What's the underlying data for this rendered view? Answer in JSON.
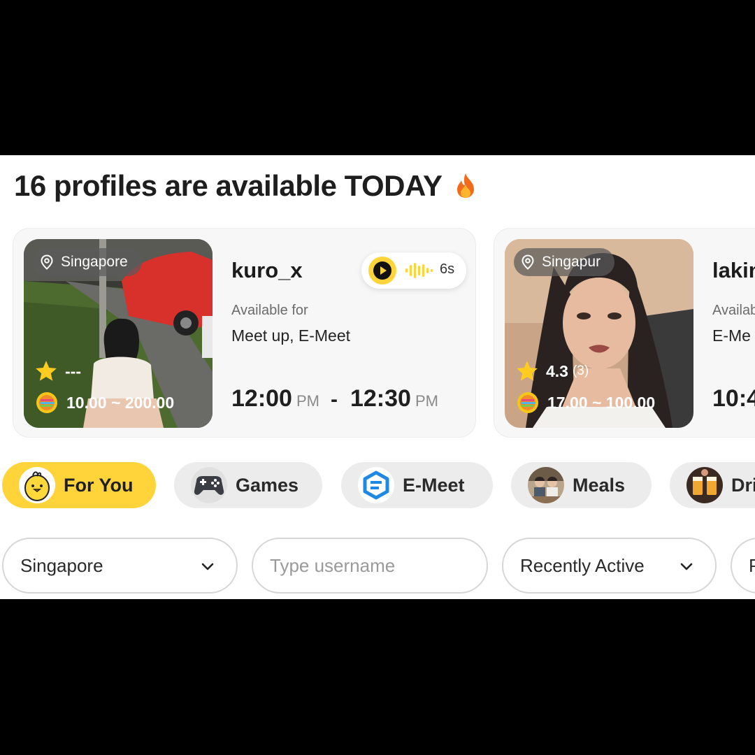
{
  "headline": "16 profiles are available TODAY",
  "profiles": [
    {
      "location": "Singapore",
      "name": "kuro_x",
      "rating": "---",
      "rating_count": "",
      "price": "10.00 ~ 200.00",
      "available_label": "Available for",
      "available": "Meet up, E-Meet",
      "start_time": "12:00",
      "start_ampm": "PM",
      "end_time": "12:30",
      "end_ampm": "PM",
      "voice_duration": "6s"
    },
    {
      "location": "Singapur",
      "name": "lakin",
      "rating": "4.3",
      "rating_count": "(3)",
      "price": "17.00 ~ 100.00",
      "available_label": "Availab",
      "available": "E-Me",
      "start_time": "10:4"
    }
  ],
  "categories": [
    {
      "label": "For You",
      "icon": "chick-icon"
    },
    {
      "label": "Games",
      "icon": "gamepad-icon"
    },
    {
      "label": "E-Meet",
      "icon": "e-meet-icon"
    },
    {
      "label": "Meals",
      "icon": "meals-icon"
    },
    {
      "label": "Dri",
      "icon": "drinks-icon"
    }
  ],
  "filters": {
    "location_value": "Singapore",
    "username_placeholder": "Type username",
    "sort_value": "Recently Active",
    "extra_value": "P"
  },
  "colors": {
    "accent": "#ffd43b",
    "chip_bg": "#ececec"
  }
}
